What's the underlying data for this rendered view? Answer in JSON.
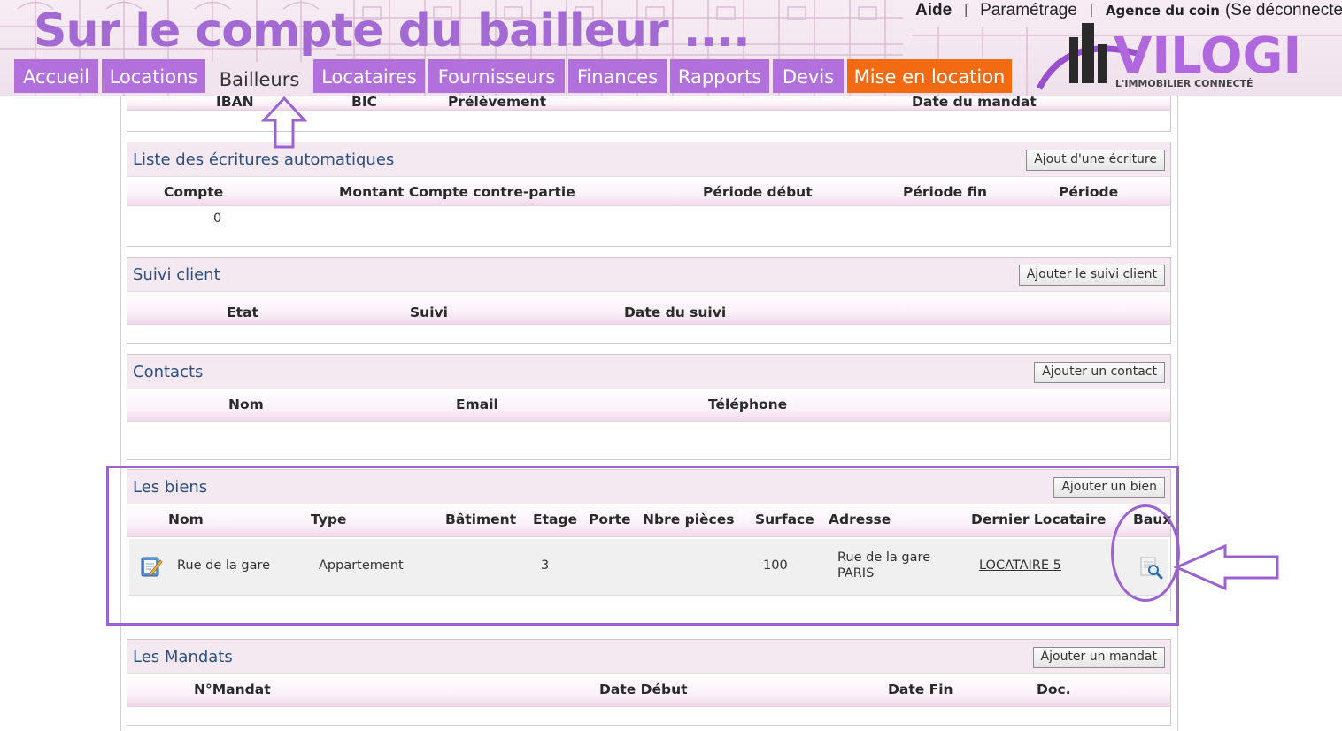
{
  "overlay_title": "Sur le compte du bailleur ....",
  "topnav": {
    "aide": "Aide",
    "parametrage": "Paramétrage",
    "agence": "Agence du coin",
    "logout": "(Se déconnecter"
  },
  "tabs": [
    {
      "label": "Accueil"
    },
    {
      "label": "Locations"
    },
    {
      "label": "Bailleurs"
    },
    {
      "label": "Locataires"
    },
    {
      "label": "Fournisseurs"
    },
    {
      "label": "Finances"
    },
    {
      "label": "Rapports"
    },
    {
      "label": "Devis"
    },
    {
      "label": "Mise en location"
    }
  ],
  "logo": {
    "name": "VILOGI",
    "tagline": "L'IMMOBILIER CONNECTÉ"
  },
  "top_columns": {
    "iban": "IBAN",
    "bic": "BIC",
    "prelevement": "Prélèvement",
    "date_mandat": "Date du mandat"
  },
  "ecritures": {
    "title": "Liste des écritures automatiques",
    "button": "Ajout d'une écriture",
    "columns": [
      "Compte",
      "Montant Compte contre-partie",
      "Période début",
      "Période fin",
      "Période"
    ],
    "rows": [
      {
        "compte": "0"
      }
    ]
  },
  "suivi": {
    "title": "Suivi client",
    "button": "Ajouter le suivi client",
    "columns": [
      "Etat",
      "Suivi",
      "Date du suivi"
    ]
  },
  "contacts": {
    "title": "Contacts",
    "button": "Ajouter un contact",
    "columns": [
      "Nom",
      "Email",
      "Téléphone"
    ]
  },
  "biens": {
    "title": "Les biens",
    "button": "Ajouter un bien",
    "columns": [
      "Nom",
      "Type",
      "Bâtiment",
      "Etage",
      "Porte",
      "Nbre pièces",
      "Surface",
      "Adresse",
      "Dernier Locataire",
      "Baux"
    ],
    "rows": [
      {
        "nom": "Rue de la gare",
        "type": "Appartement",
        "etage": "3",
        "surface": "100",
        "adresse_l1": "Rue de la gare",
        "adresse_l2": "PARIS",
        "locataire": "LOCATAIRE 5"
      }
    ]
  },
  "mandats": {
    "title": "Les Mandats",
    "button": "Ajouter un mandat",
    "columns": [
      "N°Mandat",
      "Date Début",
      "Date Fin",
      "Doc."
    ]
  },
  "colors": {
    "tab": "#b270dc",
    "tab_orange": "#f26b12",
    "panel_title": "#2d4f7d",
    "annotation": "#9b63cf"
  }
}
